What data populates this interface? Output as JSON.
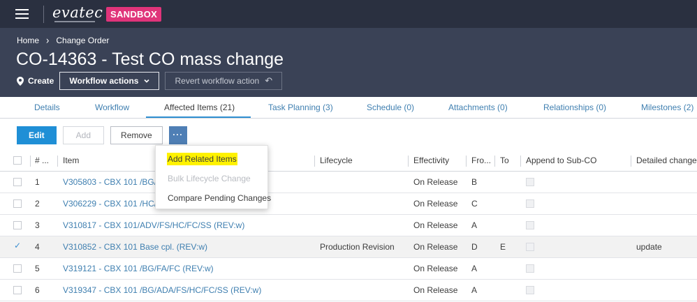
{
  "topbar": {
    "menu_icon": "hamburger-icon",
    "logo_text": "evatec",
    "env_badge": "SANDBOX"
  },
  "header": {
    "breadcrumb": [
      "Home",
      "Change Order"
    ],
    "title": "CO-14363 - Test CO mass change",
    "state_icon": "map-pin-icon",
    "state_label": "Create",
    "workflow_button": "Workflow actions",
    "revert_button": "Revert workflow action"
  },
  "tabs": [
    {
      "label": "Details",
      "active": false
    },
    {
      "label": "Workflow",
      "active": false
    },
    {
      "label": "Affected Items (21)",
      "active": true
    },
    {
      "label": "Task Planning (3)",
      "active": false
    },
    {
      "label": "Schedule (0)",
      "active": false
    },
    {
      "label": "Attachments (0)",
      "active": false
    },
    {
      "label": "Relationships (0)",
      "active": false
    },
    {
      "label": "Milestones (2)",
      "active": false
    }
  ],
  "toolbar": {
    "edit": "Edit",
    "add": "Add",
    "remove": "Remove",
    "more": "···"
  },
  "more_menu": {
    "items": [
      {
        "label": "Add Related Items",
        "enabled": true,
        "highlighted": true
      },
      {
        "label": "Bulk Lifecycle Change",
        "enabled": false
      },
      {
        "label": "Compare Pending Changes",
        "enabled": true
      }
    ],
    "highlight_color": "#fff200"
  },
  "table": {
    "columns": [
      "# ...",
      "Item",
      "Lifecycle",
      "Effectivity",
      "Fro...",
      "To",
      "Append to Sub-CO",
      "Detailed change"
    ],
    "rows": [
      {
        "num": "1",
        "item": "V305803 - CBX 101 /BG/H",
        "lifecycle": "",
        "effectivity": "On Release",
        "from": "B",
        "to": "",
        "detail": "",
        "checked": false
      },
      {
        "num": "2",
        "item": "V306229 - CBX 101 /HC/FC",
        "lifecycle": "",
        "effectivity": "On Release",
        "from": "C",
        "to": "",
        "detail": "",
        "checked": false
      },
      {
        "num": "3",
        "item": "V310817 - CBX 101/ADV/FS/HC/FC/SS (REV:w)",
        "lifecycle": "",
        "effectivity": "On Release",
        "from": "A",
        "to": "",
        "detail": "",
        "checked": false
      },
      {
        "num": "4",
        "item": "V310852 - CBX 101 Base cpl. (REV:w)",
        "lifecycle": "Production Revision",
        "effectivity": "On Release",
        "from": "D",
        "to": "E",
        "detail": "update",
        "checked": true
      },
      {
        "num": "5",
        "item": "V319121 - CBX 101 /BG/FA/FC (REV:w)",
        "lifecycle": "",
        "effectivity": "On Release",
        "from": "A",
        "to": "",
        "detail": "",
        "checked": false
      },
      {
        "num": "6",
        "item": "V319347 - CBX 101 /BG/ADA/FS/HC/FC/SS (REV:w)",
        "lifecycle": "",
        "effectivity": "On Release",
        "from": "A",
        "to": "",
        "detail": "",
        "checked": false
      }
    ]
  },
  "colors": {
    "topbar_bg": "#2a3040",
    "header_bg": "#3a4256",
    "badge": "#e0347a",
    "primary": "#1f8fd6",
    "link": "#3f7fb0"
  }
}
